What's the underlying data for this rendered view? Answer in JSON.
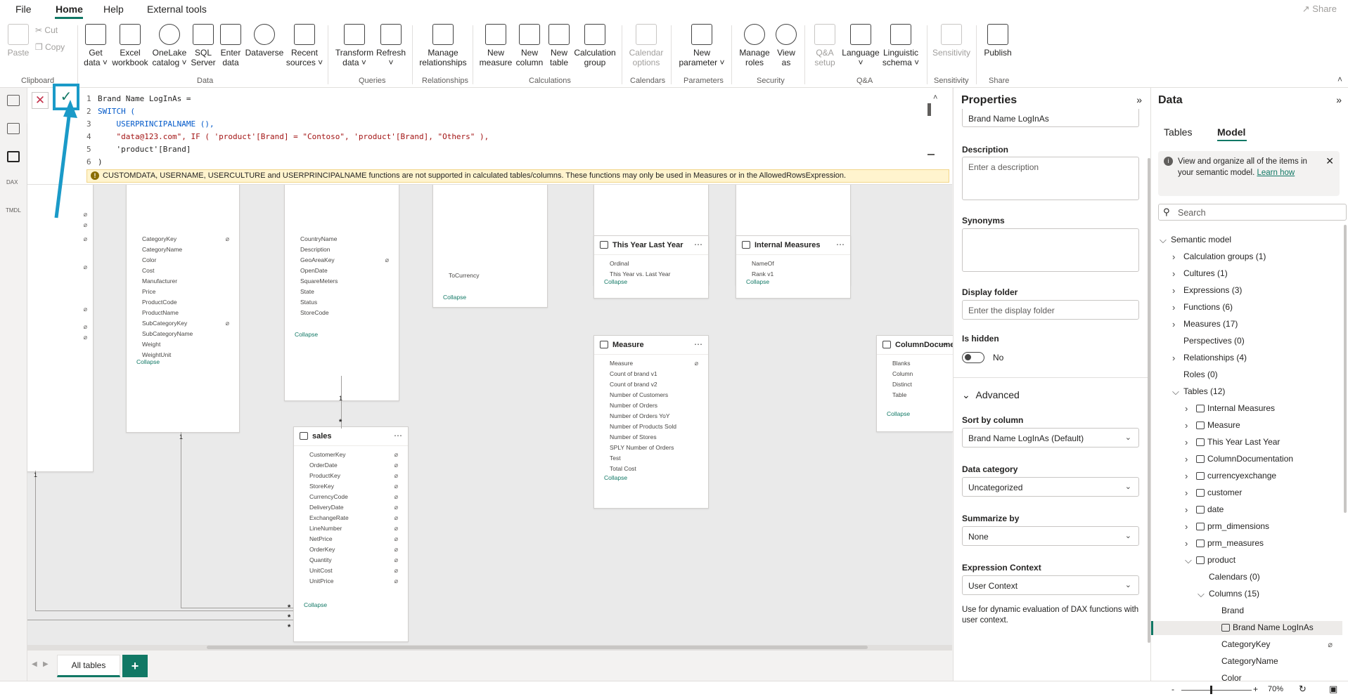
{
  "menu": {
    "file": "File",
    "home": "Home",
    "help": "Help",
    "external_tools": "External tools",
    "share": "Share"
  },
  "ribbon": {
    "clipboard": {
      "paste": "Paste",
      "cut": "Cut",
      "copy": "Copy",
      "label": "Clipboard"
    },
    "data": {
      "get_data": "Get data",
      "excel": "Excel workbook",
      "onelake": "OneLake catalog",
      "sql": "SQL Server",
      "enter": "Enter data",
      "dataverse": "Dataverse",
      "recent": "Recent sources",
      "label": "Data"
    },
    "queries": {
      "transform": "Transform data",
      "refresh": "Refresh",
      "label": "Queries"
    },
    "relationships": {
      "manage": "Manage relationships",
      "label": "Relationships"
    },
    "calculations": {
      "new_measure": "New measure",
      "new_column": "New column",
      "new_table": "New table",
      "calc_group": "Calculation group",
      "label": "Calculations"
    },
    "calendars": {
      "options": "Calendar options",
      "label": "Calendars"
    },
    "parameters": {
      "new_param": "New parameter",
      "label": "Parameters"
    },
    "security": {
      "manage_roles": "Manage roles",
      "view_as": "View as",
      "label": "Security"
    },
    "qa": {
      "setup": "Q&A setup",
      "language": "Language",
      "schema": "Linguistic schema",
      "label": "Q&A"
    },
    "sensitivity": {
      "sensitivity": "Sensitivity",
      "label": "Sensitivity"
    },
    "share": {
      "publish": "Publish",
      "label": "Share"
    }
  },
  "formula": {
    "lines": [
      "Brand Name LogInAs =",
      "SWITCH (",
      "    USERPRINCIPALNAME (),",
      "    \"data@123.com\", IF ( 'product'[Brand] = \"Contoso\", 'product'[Brand], \"Others\" ),",
      "    'product'[Brand]",
      ")"
    ],
    "line_numbers": [
      "1",
      "2",
      "3",
      "4",
      "5",
      "6"
    ],
    "warning": "CUSTOMDATA, USERNAME, USERCULTURE and USERPRINCIPALNAME functions are not supported in calculated tables/columns. These functions may only be used in Measures or in the AllowedRowsExpression."
  },
  "canvas": {
    "collapse": "Collapse",
    "product_fields": [
      "CategoryKey",
      "CategoryName",
      "Color",
      "Cost",
      "Manufacturer",
      "Price",
      "ProductCode",
      "ProductName",
      "SubCategoryKey",
      "SubCategoryName",
      "Weight",
      "WeightUnit"
    ],
    "store_fields": [
      "CountryName",
      "Description",
      "GeoAreaKey",
      "OpenDate",
      "SquareMeters",
      "State",
      "Status",
      "StoreCode"
    ],
    "currency_field": "ToCurrency",
    "this_year": {
      "title": "This Year Last Year",
      "fields": [
        "Ordinal",
        "This Year vs. Last Year"
      ]
    },
    "internal": {
      "title": "Internal Measures",
      "fields": [
        "NameOf",
        "Rank v1"
      ]
    },
    "measure": {
      "title": "Measure",
      "fields": [
        "Measure",
        "Count of brand v1",
        "Count of brand v2",
        "Number of Customers",
        "Number of Orders",
        "Number of Orders YoY",
        "Number of Products Sold",
        "Number of Stores",
        "SPLY Number of Orders",
        "Test",
        "Total Cost"
      ]
    },
    "coldoc": {
      "title": "ColumnDocumentation",
      "fields": [
        "Blanks",
        "Column",
        "Distinct",
        "Table"
      ]
    },
    "sales": {
      "title": "sales",
      "fields": [
        "CustomerKey",
        "OrderDate",
        "ProductKey",
        "StoreKey",
        "CurrencyCode",
        "DeliveryDate",
        "ExchangeRate",
        "LineNumber",
        "NetPrice",
        "OrderKey",
        "Quantity",
        "UnitCost",
        "UnitPrice"
      ]
    },
    "rel_one": "1",
    "rel_many": "*"
  },
  "tabs": {
    "all_tables": "All tables",
    "add": "+"
  },
  "status": {
    "zoom": "70%",
    "minus": "-",
    "plus": "+"
  },
  "properties": {
    "title": "Properties",
    "name_value": "Brand Name LogInAs",
    "description_label": "Description",
    "description_placeholder": "Enter a description",
    "synonyms_label": "Synonyms",
    "display_folder_label": "Display folder",
    "display_folder_placeholder": "Enter the display folder",
    "is_hidden_label": "Is hidden",
    "is_hidden_value": "No",
    "advanced": "Advanced",
    "sort_by_label": "Sort by column",
    "sort_by_value": "Brand Name LogInAs (Default)",
    "data_category_label": "Data category",
    "data_category_value": "Uncategorized",
    "summarize_label": "Summarize by",
    "summarize_value": "None",
    "expr_ctx_label": "Expression Context",
    "expr_ctx_value": "User Context",
    "expr_ctx_help": "Use for dynamic evaluation of DAX functions with user context."
  },
  "data_pane": {
    "title": "Data",
    "tab_tables": "Tables",
    "tab_model": "Model",
    "info": "View and organize all of the items in your semantic model.",
    "learn_how": "Learn how",
    "search_placeholder": "Search",
    "tree": {
      "semantic_model": "Semantic model",
      "calc_groups": "Calculation groups (1)",
      "cultures": "Cultures (1)",
      "expressions": "Expressions (3)",
      "functions": "Functions (6)",
      "measures": "Measures (17)",
      "perspectives": "Perspectives (0)",
      "relationships": "Relationships (4)",
      "roles": "Roles (0)",
      "tables": "Tables (12)",
      "table_items": [
        "Internal Measures",
        "Measure",
        "This Year Last Year",
        "ColumnDocumentation",
        "currencyexchange",
        "customer",
        "date",
        "prm_dimensions",
        "prm_measures",
        "product"
      ],
      "calendars": "Calendars (0)",
      "columns": "Columns (15)",
      "column_items": [
        "Brand",
        "Brand Name LogInAs",
        "CategoryKey",
        "CategoryName",
        "Color"
      ]
    }
  },
  "colors": {
    "accent": "#117865",
    "highlight": "#1a9ac8",
    "warning_bg": "#fff4ce"
  }
}
